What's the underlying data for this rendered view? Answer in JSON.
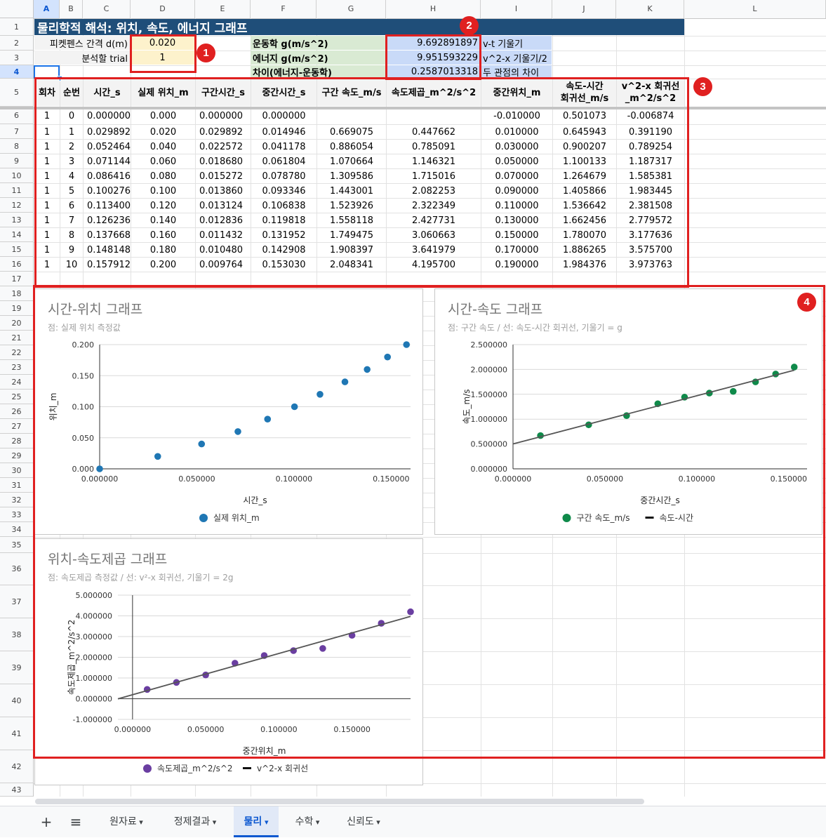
{
  "columns": [
    "A",
    "B",
    "C",
    "D",
    "E",
    "F",
    "G",
    "H",
    "I",
    "J",
    "K",
    "L"
  ],
  "rows": [
    "1",
    "2",
    "3",
    "4",
    "5",
    "6",
    "7",
    "8",
    "9",
    "10",
    "11",
    "12",
    "13",
    "14",
    "15",
    "16",
    "17",
    "18",
    "19",
    "20",
    "21",
    "22",
    "23",
    "24",
    "25",
    "26",
    "27",
    "28",
    "29",
    "30",
    "31",
    "32",
    "33",
    "34",
    "35",
    "36",
    "37",
    "38",
    "39",
    "40",
    "41",
    "42",
    "43"
  ],
  "title": "물리학적 해석: 위치, 속도, 에너지 그래프",
  "params": {
    "picket_label": "피켓펜스 간격 d(m)",
    "picket_value": "0.020",
    "trial_label": "분석할 trial",
    "trial_value": "1"
  },
  "results": {
    "kin_label": "운동학 g(m/s^2)",
    "kin_value": "9.692891897",
    "kin_note": "v-t 기울기",
    "energy_label": "에너지 g(m/s^2)",
    "energy_value": "9.951593229",
    "energy_note": "v^2-x 기울기/2",
    "diff_label": "차이(에너지-운동학)",
    "diff_value": "0.2587013318",
    "diff_note": "두 관점의 차이"
  },
  "table": {
    "headers": [
      "회차",
      "순번",
      "시간_s",
      "실제 위치_m",
      "구간시간_s",
      "중간시간_s",
      "구간 속도_m/s",
      "속도제곱_m^2/s^2",
      "중간위치_m",
      "속도-시간\n회귀선_m/s",
      "v^2-x 회귀선\n_m^2/s^2"
    ],
    "rows": [
      [
        "1",
        "0",
        "0.000000",
        "0.000",
        "0.000000",
        "0.000000",
        "",
        "",
        "-0.010000",
        "0.501073",
        "-0.006874"
      ],
      [
        "1",
        "1",
        "0.029892",
        "0.020",
        "0.029892",
        "0.014946",
        "0.669075",
        "0.447662",
        "0.010000",
        "0.645943",
        "0.391190"
      ],
      [
        "1",
        "2",
        "0.052464",
        "0.040",
        "0.022572",
        "0.041178",
        "0.886054",
        "0.785091",
        "0.030000",
        "0.900207",
        "0.789254"
      ],
      [
        "1",
        "3",
        "0.071144",
        "0.060",
        "0.018680",
        "0.061804",
        "1.070664",
        "1.146321",
        "0.050000",
        "1.100133",
        "1.187317"
      ],
      [
        "1",
        "4",
        "0.086416",
        "0.080",
        "0.015272",
        "0.078780",
        "1.309586",
        "1.715016",
        "0.070000",
        "1.264679",
        "1.585381"
      ],
      [
        "1",
        "5",
        "0.100276",
        "0.100",
        "0.013860",
        "0.093346",
        "1.443001",
        "2.082253",
        "0.090000",
        "1.405866",
        "1.983445"
      ],
      [
        "1",
        "6",
        "0.113400",
        "0.120",
        "0.013124",
        "0.106838",
        "1.523926",
        "2.322349",
        "0.110000",
        "1.536642",
        "2.381508"
      ],
      [
        "1",
        "7",
        "0.126236",
        "0.140",
        "0.012836",
        "0.119818",
        "1.558118",
        "2.427731",
        "0.130000",
        "1.662456",
        "2.779572"
      ],
      [
        "1",
        "8",
        "0.137668",
        "0.160",
        "0.011432",
        "0.131952",
        "1.749475",
        "3.060663",
        "0.150000",
        "1.780070",
        "3.177636"
      ],
      [
        "1",
        "9",
        "0.148148",
        "0.180",
        "0.010480",
        "0.142908",
        "1.908397",
        "3.641979",
        "0.170000",
        "1.886265",
        "3.575700"
      ],
      [
        "1",
        "10",
        "0.157912",
        "0.200",
        "0.009764",
        "0.153030",
        "2.048341",
        "4.195700",
        "0.190000",
        "1.984376",
        "3.973763"
      ]
    ]
  },
  "badges": [
    "1",
    "2",
    "3",
    "4"
  ],
  "chart_data": [
    {
      "type": "scatter",
      "title": "시간-위치 그래프",
      "subtitle": "점: 실제 위치 측정값",
      "xlabel": "시간_s",
      "ylabel": "위치_m",
      "xlim": [
        0,
        0.16
      ],
      "ylim": [
        0,
        0.2
      ],
      "xticks": [
        "0.000000",
        "0.050000",
        "0.100000",
        "0.150000"
      ],
      "yticks": [
        "0.000",
        "0.050",
        "0.100",
        "0.150",
        "0.200"
      ],
      "grid": true,
      "legend": "bottom",
      "series": [
        {
          "name": "실제 위치_m",
          "color": "#1f77b4",
          "x": [
            0.0,
            0.029892,
            0.052464,
            0.071144,
            0.086416,
            0.100276,
            0.1134,
            0.126236,
            0.137668,
            0.148148,
            0.157912
          ],
          "y": [
            0.0,
            0.02,
            0.04,
            0.06,
            0.08,
            0.1,
            0.12,
            0.14,
            0.16,
            0.18,
            0.2
          ]
        }
      ]
    },
    {
      "type": "scatter",
      "title": "시간-속도 그래프",
      "subtitle": "점: 구간 속도 / 선: 속도-시간 회귀선, 기울기 = g",
      "xlabel": "중간시간_s",
      "ylabel": "속도_m/s",
      "xlim": [
        0,
        0.16
      ],
      "ylim": [
        0,
        2.5
      ],
      "xticks": [
        "0.000000",
        "0.050000",
        "0.100000",
        "0.150000"
      ],
      "yticks": [
        "0.000000",
        "0.500000",
        "1.000000",
        "1.500000",
        "2.000000",
        "2.500000"
      ],
      "grid": true,
      "legend": "bottom",
      "series": [
        {
          "name": "구간 속도_m/s",
          "color": "#0f8a4a",
          "x": [
            0.014946,
            0.041178,
            0.061804,
            0.07878,
            0.093346,
            0.106838,
            0.119818,
            0.131952,
            0.142908,
            0.15303
          ],
          "y": [
            0.669075,
            0.886054,
            1.070664,
            1.309586,
            1.443001,
            1.523926,
            1.558118,
            1.749475,
            1.908397,
            2.048341
          ]
        },
        {
          "name": "속도-시간",
          "color": "#555555",
          "kind": "line",
          "x": [
            0.0,
            0.15303
          ],
          "y": [
            0.501073,
            1.984376
          ]
        }
      ]
    },
    {
      "type": "scatter",
      "title": "위치-속도제곱 그래프",
      "subtitle": "점: 속도제곱 측정값 / 선: v²-x 회귀선, 기울기 = 2g",
      "xlabel": "중간위치_m",
      "ylabel": "속도제곱_m^2/s^2",
      "xlim": [
        -0.01,
        0.19
      ],
      "ylim": [
        -1,
        5
      ],
      "xticks": [
        "0.000000",
        "0.050000",
        "0.100000",
        "0.150000"
      ],
      "yticks": [
        "-1.000000",
        "0.000000",
        "1.000000",
        "2.000000",
        "3.000000",
        "4.000000",
        "5.000000"
      ],
      "grid": true,
      "legend": "bottom",
      "series": [
        {
          "name": "속도제곱_m^2/s^2",
          "color": "#6a3ea1",
          "x": [
            0.01,
            0.03,
            0.05,
            0.07,
            0.09,
            0.11,
            0.13,
            0.15,
            0.17,
            0.19
          ],
          "y": [
            0.447662,
            0.785091,
            1.146321,
            1.715016,
            2.082253,
            2.322349,
            2.427731,
            3.060663,
            3.641979,
            4.1957
          ]
        },
        {
          "name": "v^2-x 회귀선",
          "color": "#555555",
          "kind": "line",
          "x": [
            -0.01,
            0.19
          ],
          "y": [
            -0.006874,
            3.973763
          ]
        }
      ]
    }
  ],
  "tabs": {
    "add": "+",
    "menu": "≡",
    "items": [
      "원자료",
      "정제결과",
      "물리",
      "수학",
      "신뢰도"
    ],
    "active": "물리"
  }
}
